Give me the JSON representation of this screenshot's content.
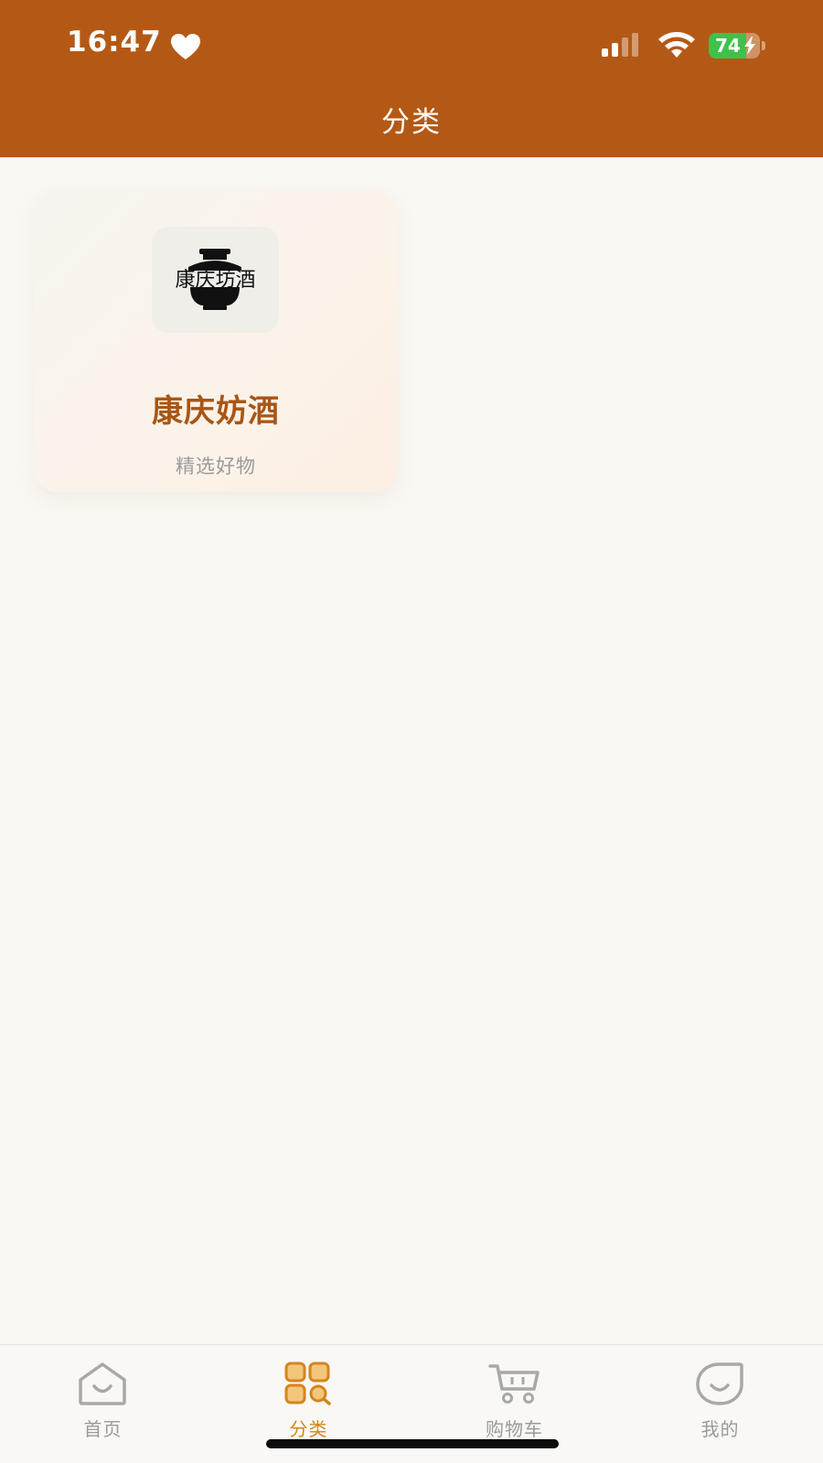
{
  "status_bar": {
    "time": "16:47",
    "battery_level": 74,
    "battery_text": "74",
    "icons": [
      "heart-icon",
      "signal-icon",
      "wifi-icon",
      "battery-charging-icon"
    ]
  },
  "header": {
    "title": "分类",
    "background_color": "#b45915"
  },
  "categories": [
    {
      "logo_text": "康庆坊酒",
      "name": "康庆妨酒",
      "subtitle": "精选好物"
    }
  ],
  "tab_bar": {
    "active_color": "#d2861f",
    "inactive_color": "#9a9a9a",
    "tabs": [
      {
        "label": "首页",
        "icon": "home-icon",
        "active": false
      },
      {
        "label": "分类",
        "icon": "category-grid-icon",
        "active": true
      },
      {
        "label": "购物车",
        "icon": "cart-icon",
        "active": false
      },
      {
        "label": "我的",
        "icon": "profile-icon",
        "active": false
      }
    ]
  }
}
